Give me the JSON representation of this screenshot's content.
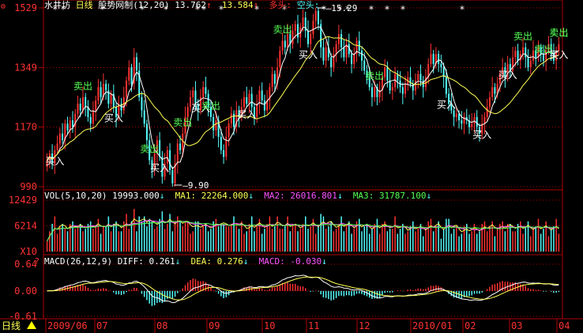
{
  "title_bar": {
    "stock_name": "水井坊",
    "period": "日线",
    "indicator": "股势网制(12,20)",
    "value1": "13.762",
    "arrow1": "↑",
    "value2": "13.584",
    "arrow2": "↑",
    "long_label": "多头:",
    "short_label": "空头:"
  },
  "period_badge": "日线",
  "colors": {
    "up": "#ff3232",
    "down": "#54fcfc",
    "white_line": "#ffffff",
    "yellow_line": "#ffff54",
    "magenta_line": "#ff54ff",
    "green_line": "#54ff54",
    "grid": "#b00000",
    "axis_text": "#ff3232",
    "buy_label": "#ffffff",
    "sell_label": "#54ff54"
  },
  "chart_data": [
    {
      "type": "candlestick",
      "title": "股势网制(12,20)",
      "ylim": [
        990,
        1529
      ],
      "y_ticks": [
        "1529",
        "1349",
        "1170",
        "990"
      ],
      "high_label": "15.29",
      "low_label": "9.90",
      "signals": [
        {
          "label": "买入",
          "x": 3
        },
        {
          "label": "卖出",
          "x": 14
        },
        {
          "label": "买入",
          "x": 26
        },
        {
          "label": "卖出",
          "x": 40
        },
        {
          "label": "买入",
          "x": 44
        },
        {
          "label": "卖出",
          "x": 53
        },
        {
          "label": "买入",
          "x": 60
        },
        {
          "label": "卖出",
          "x": 64
        },
        {
          "label": "买入",
          "x": 78
        },
        {
          "label": "卖出",
          "x": 92
        },
        {
          "label": "买入",
          "x": 102
        },
        {
          "label": "卖出",
          "x": 128
        },
        {
          "label": "买入",
          "x": 156
        },
        {
          "label": "卖出",
          "x": 186
        },
        {
          "label": "买入",
          "x": 170
        },
        {
          "label": "卖出",
          "x": 194
        },
        {
          "label": "买入",
          "x": 180
        },
        {
          "label": "卖出",
          "x": 202
        },
        {
          "label": "买入",
          "x": 216
        },
        {
          "label": "卖出",
          "x": 244
        }
      ],
      "close": [
        10.7,
        10.9,
        10.6,
        11.0,
        11.2,
        11.5,
        11.3,
        11.8,
        11.6,
        11.9,
        11.7,
        12.1,
        12.4,
        12.2,
        12.6,
        12.3,
        12.0,
        11.8,
        12.2,
        12.5,
        12.9,
        12.6,
        13.0,
        12.8,
        12.4,
        12.7,
        12.3,
        12.0,
        12.4,
        12.2,
        12.6,
        13.1,
        13.5,
        13.0,
        13.8,
        13.4,
        12.6,
        12.2,
        11.8,
        11.3,
        10.7,
        10.4,
        10.9,
        11.3,
        10.8,
        10.2,
        10.6,
        11.0,
        10.4,
        10.0,
        10.6,
        11.2,
        11.0,
        11.5,
        12.0,
        12.3,
        12.6,
        12.8,
        12.4,
        12.2,
        12.6,
        12.9,
        12.7,
        12.3,
        12.0,
        11.6,
        11.9,
        11.4,
        11.0,
        10.8,
        11.4,
        11.8,
        12.1,
        11.7,
        12.2,
        12.0,
        12.3,
        12.6,
        12.4,
        12.7,
        12.3,
        12.0,
        12.4,
        12.8,
        12.5,
        12.2,
        12.5,
        12.9,
        13.3,
        13.0,
        13.5,
        14.0,
        14.3,
        14.1,
        14.5,
        14.2,
        14.6,
        14.8,
        14.4,
        14.7,
        15.0,
        14.6,
        14.2,
        14.5,
        14.9,
        15.2,
        14.8,
        14.1,
        13.7,
        14.1,
        13.8,
        13.5,
        13.9,
        14.2,
        14.5,
        14.1,
        13.8,
        14.2,
        13.9,
        13.6,
        13.9,
        14.3,
        14.0,
        13.7,
        13.4,
        13.2,
        12.9,
        12.6,
        12.9,
        12.6,
        12.8,
        13.2,
        13.5,
        13.1,
        12.8,
        12.9,
        13.3,
        13.1,
        12.9,
        12.7,
        13.0,
        13.2,
        13.0,
        12.8,
        13.1,
        13.3,
        13.1,
        12.9,
        13.2,
        13.6,
        13.9,
        13.6,
        13.9,
        13.6,
        13.5,
        13.2,
        12.7,
        12.4,
        12.2,
        12.0,
        12.1,
        11.9,
        11.8,
        12.0,
        11.9,
        11.7,
        11.8,
        12.0,
        11.7,
        11.5,
        11.8,
        12.0,
        12.3,
        12.6,
        12.9,
        12.7,
        13.0,
        13.3,
        13.5,
        13.2,
        13.6,
        13.4,
        13.8,
        14.0,
        13.7,
        13.9,
        14.1,
        13.8,
        13.5,
        13.7,
        14.0,
        13.8,
        14.1,
        13.9,
        13.7,
        14.0,
        14.2,
        13.9,
        13.7,
        14.0,
        14.2
      ],
      "ma_white": "close 5-day average",
      "ma_yellow": "close 20-day average"
    },
    {
      "type": "bar",
      "title": "VOL(5,10,20)",
      "ylim": [
        0,
        12429
      ],
      "y_ticks": [
        "12429",
        "6214",
        "X10"
      ],
      "series": [
        {
          "name": "VOL",
          "value": "19993.000",
          "arrow": "↓"
        },
        {
          "name": "MA1",
          "value": "22264.000",
          "arrow": "↓"
        },
        {
          "name": "MA2",
          "value": "26016.801",
          "arrow": "↓"
        },
        {
          "name": "MA3",
          "value": "31787.100",
          "arrow": "↓"
        }
      ]
    },
    {
      "type": "bar",
      "title": "MACD(26,12,9)",
      "ylim": [
        -0.61,
        0.64
      ],
      "y_ticks": [
        "0.64",
        "0.00",
        "-0.61"
      ],
      "series": [
        {
          "name": "DIFF",
          "value": "0.261",
          "arrow": "↓"
        },
        {
          "name": "DEA",
          "value": "0.276",
          "arrow": "↓"
        },
        {
          "name": "MACD",
          "value": "-0.030",
          "arrow": "↓"
        }
      ]
    }
  ],
  "x_axis": {
    "labels": [
      "2009/06",
      "07",
      "08",
      "09",
      "10",
      "11",
      "12",
      "2010/01",
      "02",
      "03",
      "04"
    ]
  }
}
